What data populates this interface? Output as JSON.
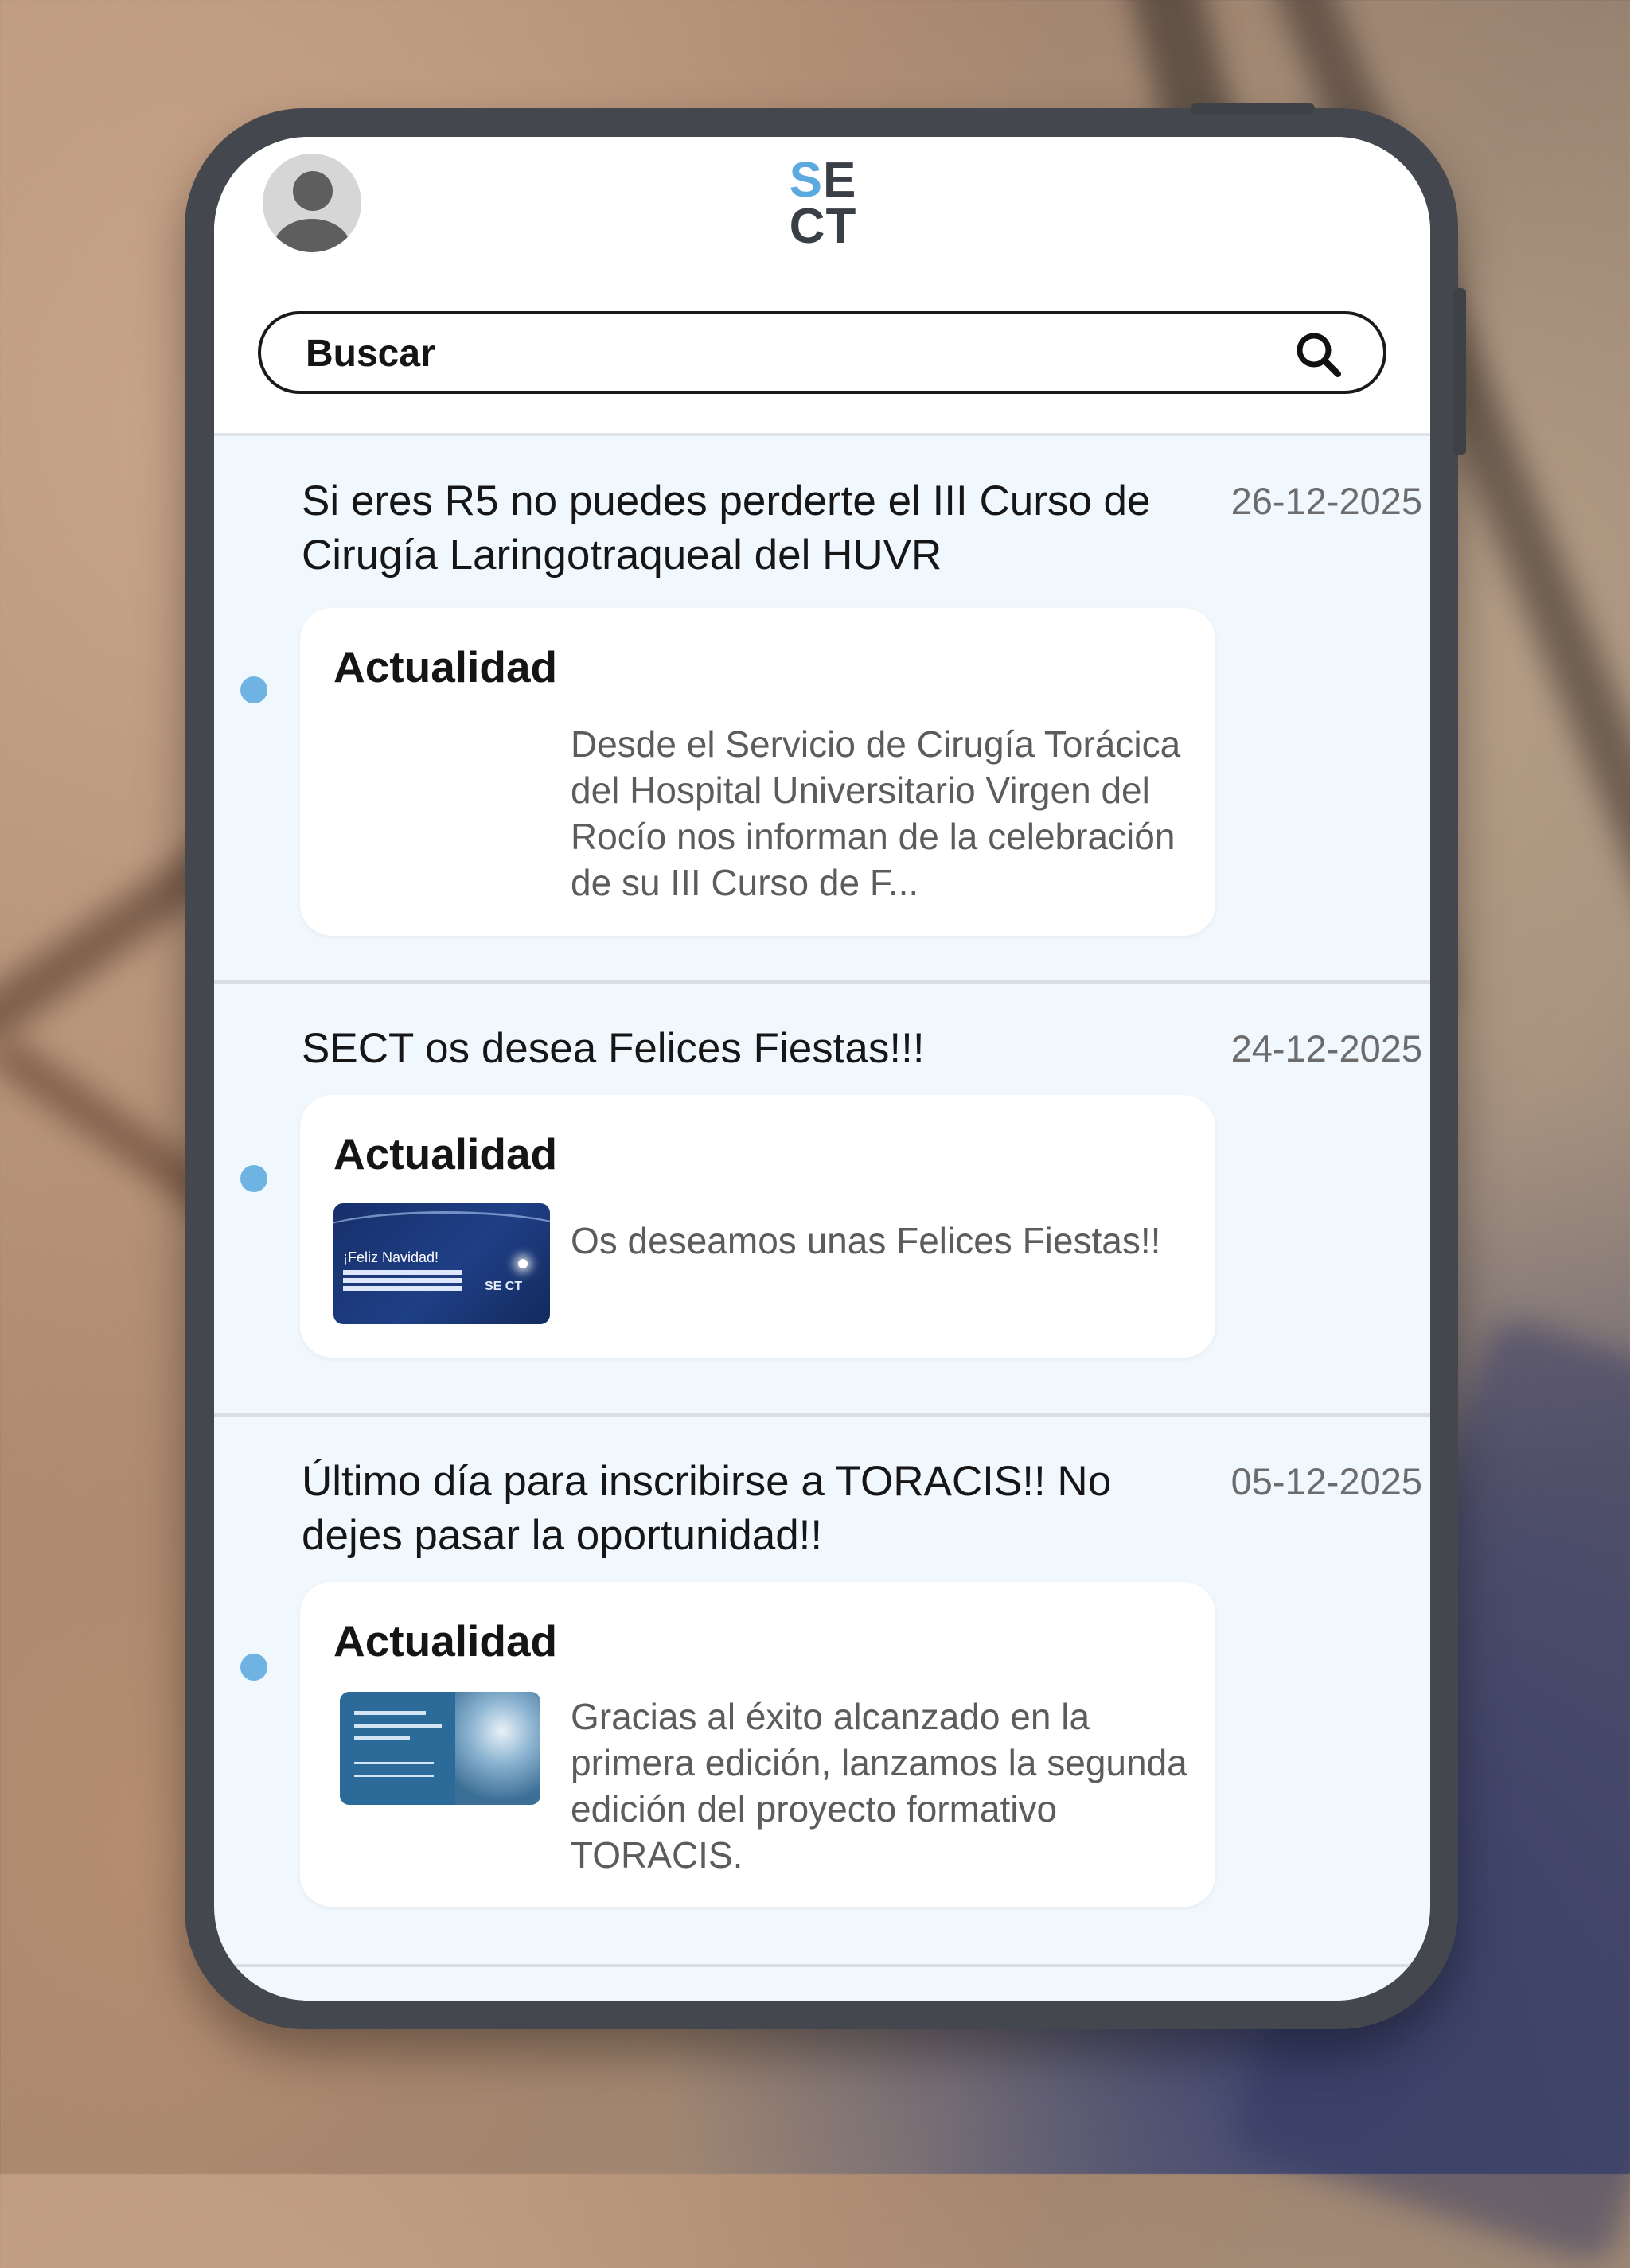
{
  "app": {
    "logo_top_accent": "S",
    "logo_top_rest": "E",
    "logo_bottom": "CT",
    "accent_color": "#5aa9df"
  },
  "search": {
    "placeholder": "Buscar",
    "icon": "search-icon"
  },
  "feed": [
    {
      "title": "Si eres R5 no puedes perderte el III Curso de Cirugía Laringotraqueal del HUVR",
      "date": "26-12-2025",
      "category": "Actualidad",
      "excerpt": "Desde el Servicio de Cirugía Torácica del Hospital Universitario Virgen del Rocío nos informan de la celebración de su III Curso de F...",
      "has_image": false
    },
    {
      "title": "SECT os desea Felices Fiestas!!!",
      "date": "24-12-2025",
      "category": "Actualidad",
      "excerpt": "Os deseamos unas Felices Fiestas!!",
      "has_image": true,
      "image_text": "¡Feliz Navidad!",
      "image_logo": "SE CT"
    },
    {
      "title": "Último día para inscribirse a TORACIS!! No dejes pasar la oportunidad!!",
      "date": "05-12-2025",
      "category": "Actualidad",
      "excerpt": "Gracias al éxito alcanzado en la primera edición, lanzamos la segunda edición del proyecto formativo TORACIS.",
      "has_image": true
    }
  ]
}
